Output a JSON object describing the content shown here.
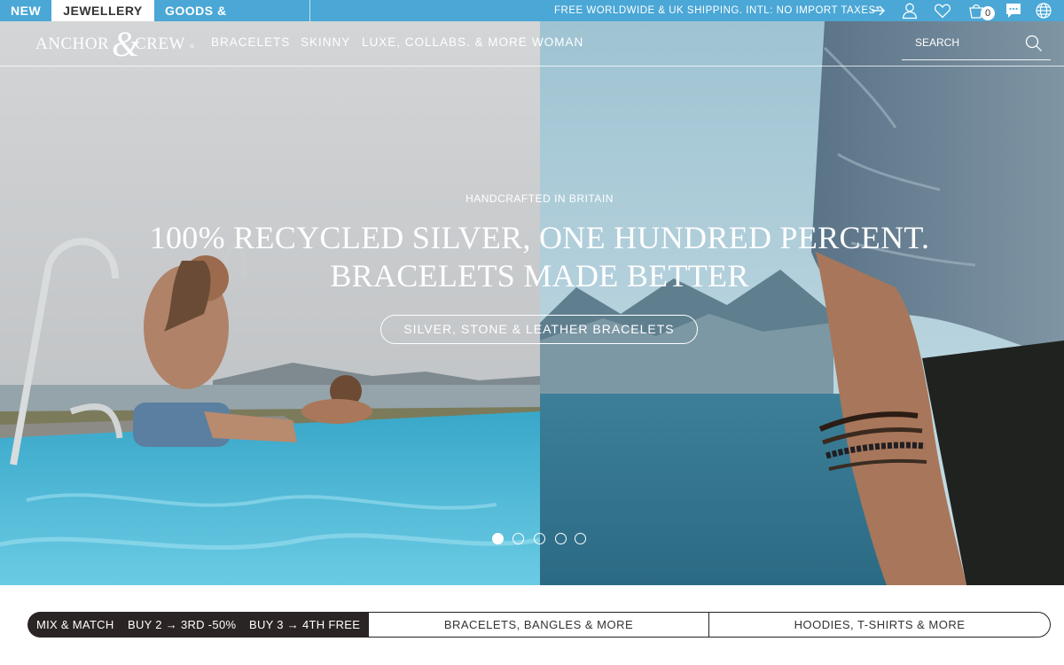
{
  "topbar": {
    "tabs": [
      {
        "label": "NEW"
      },
      {
        "label": "JEWELLERY"
      },
      {
        "label": "GOODS & CLOTHING"
      }
    ],
    "shipping_text": "FREE WORLDWIDE & UK SHIPPING. INTL: NO IMPORT TAXES*",
    "cart_count": "0",
    "icons": [
      "arrow-right-icon",
      "user-icon",
      "heart-icon",
      "shopping-bag-icon",
      "chat-icon",
      "globe-icon"
    ]
  },
  "brand": {
    "logo_word1": "ANCHOR",
    "logo_amp": "&",
    "logo_word2": "CREW",
    "logo_reg": "®"
  },
  "nav": {
    "items": [
      {
        "label": "BRACELETS"
      },
      {
        "label": "SKINNY"
      },
      {
        "label": "LUXE, COLLABS. & MORE"
      },
      {
        "label": "WOMAN"
      }
    ],
    "search_placeholder": "SEARCH"
  },
  "hero": {
    "eyebrow": "HANDCRAFTED IN BRITAIN",
    "headline_line1": "100% RECYCLED SILVER, ONE HUNDRED PERCENT.",
    "headline_line2": "BRACELETS MADE BETTER",
    "cta_label": "SILVER, STONE & LEATHER BRACELETS",
    "slides_total": 5,
    "active_slide": 1
  },
  "bottom": {
    "promo": {
      "part1": "MIX & MATCH",
      "part2": "BUY 2 → 3RD -50%",
      "part3": "BUY 3 → 4TH FREE"
    },
    "buttons": [
      {
        "label": "BRACELETS, BANGLES & MORE"
      },
      {
        "label": "HOODIES, T-SHIRTS & MORE"
      }
    ]
  },
  "colors": {
    "topbar_bg": "#4aa7d6",
    "promo_bg": "#2b2424",
    "text_light": "#ffffff"
  }
}
